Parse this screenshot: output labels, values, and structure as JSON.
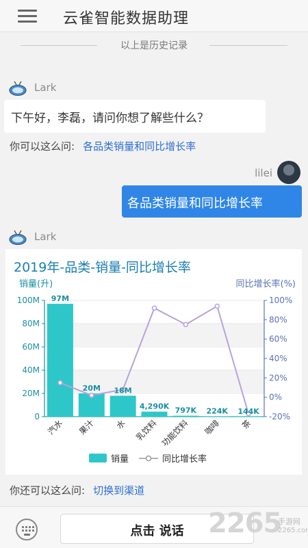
{
  "header": {
    "title": "云雀智能数据助理"
  },
  "history_divider": "以上是历史记录",
  "bot": {
    "name": "Lark"
  },
  "messages": {
    "greeting": "下午好，李磊，请问你想了解些什么？",
    "suggest_prompt": "你可以这么问:",
    "suggest_link": "各品类销量和同比增长率",
    "user_name": "lilei",
    "user_message": "各品类销量和同比增长率",
    "more_prompt": "你还可以这么问:",
    "more_link": "切换到渠道"
  },
  "chart_data": {
    "type": "bar",
    "title": "2019年-品类-销量-同比增长率",
    "ylabel": "销量(升)",
    "y2label": "同比增长率(%)",
    "categories": [
      "汽水",
      "果汁",
      "水",
      "乳饮料",
      "功能饮料",
      "咖啡",
      "茶"
    ],
    "ylim": [
      0,
      100000000
    ],
    "y_ticks": [
      "0",
      "20M",
      "40M",
      "60M",
      "80M",
      "100M"
    ],
    "y2lim": [
      -20,
      100
    ],
    "y2_ticks": [
      "-20%",
      "0%",
      "20%",
      "40%",
      "60%",
      "80%",
      "100%"
    ],
    "series": [
      {
        "name": "销量",
        "type": "bar",
        "values": [
          97000000,
          20000000,
          18000000,
          4290000,
          797000,
          224000,
          144000
        ],
        "labels": [
          "97M",
          "20M",
          "18M",
          "4,290K",
          "797K",
          "224K",
          "144K"
        ]
      },
      {
        "name": "同比增长率",
        "type": "line",
        "values": [
          15,
          2,
          8,
          92,
          75,
          94,
          -17
        ]
      }
    ],
    "colors": {
      "bar": "#2ec7c9",
      "line": "#b6a2de",
      "axis_left": "#1a8fa0",
      "axis_right": "#5a72b8",
      "label": "#1a8fa0"
    },
    "legend_position": "bottom",
    "grid": "alternating-bands"
  },
  "bottom": {
    "talk_label": "点击 说话",
    "keyboard_icon": "keyboard-icon"
  },
  "watermark": {
    "number": "2265",
    "suffix": "手游网",
    "domain": "2265.com"
  }
}
